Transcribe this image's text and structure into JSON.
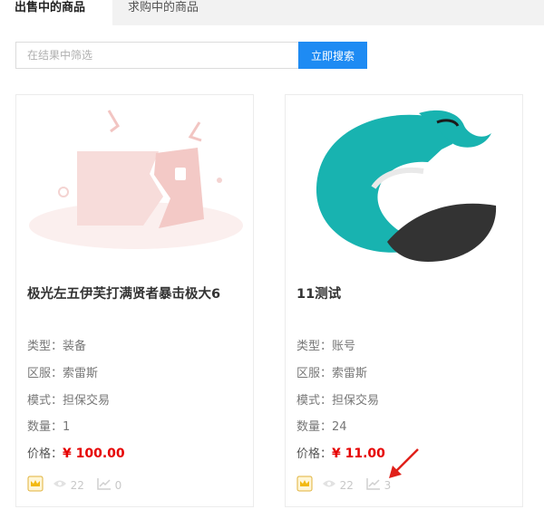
{
  "tabs": [
    {
      "label": "出售中的商品",
      "active": true
    },
    {
      "label": "求购中的商品",
      "active": false
    }
  ],
  "search": {
    "placeholder": "在结果中筛选",
    "button_label": "立即搜索"
  },
  "cards": [
    {
      "title": "极光左五伊芙打满贤者暴击极大6",
      "image_icon": "broken-image-placeholder-icon",
      "fields": [
        {
          "label": "类型：",
          "value": "装备"
        },
        {
          "label": "区服：",
          "value": "索雷斯"
        },
        {
          "label": "模式：",
          "value": "担保交易"
        },
        {
          "label": "数量：",
          "value": "1"
        }
      ],
      "price_label": "价格：",
      "price": "¥ 100.00",
      "views": "22",
      "trend": "0"
    },
    {
      "title": "11测试",
      "image_icon": "game-logo-icon",
      "fields": [
        {
          "label": "类型：",
          "value": "账号"
        },
        {
          "label": "区服：",
          "value": "索雷斯"
        },
        {
          "label": "模式：",
          "value": "担保交易"
        },
        {
          "label": "数量：",
          "value": "24"
        }
      ],
      "price_label": "价格：",
      "price": "¥ 11.00",
      "views": "22",
      "trend": "3"
    }
  ],
  "colors": {
    "accent": "#1e8bf3",
    "price": "#e60000",
    "logo_teal": "#18b3b0",
    "logo_dark": "#333333"
  }
}
